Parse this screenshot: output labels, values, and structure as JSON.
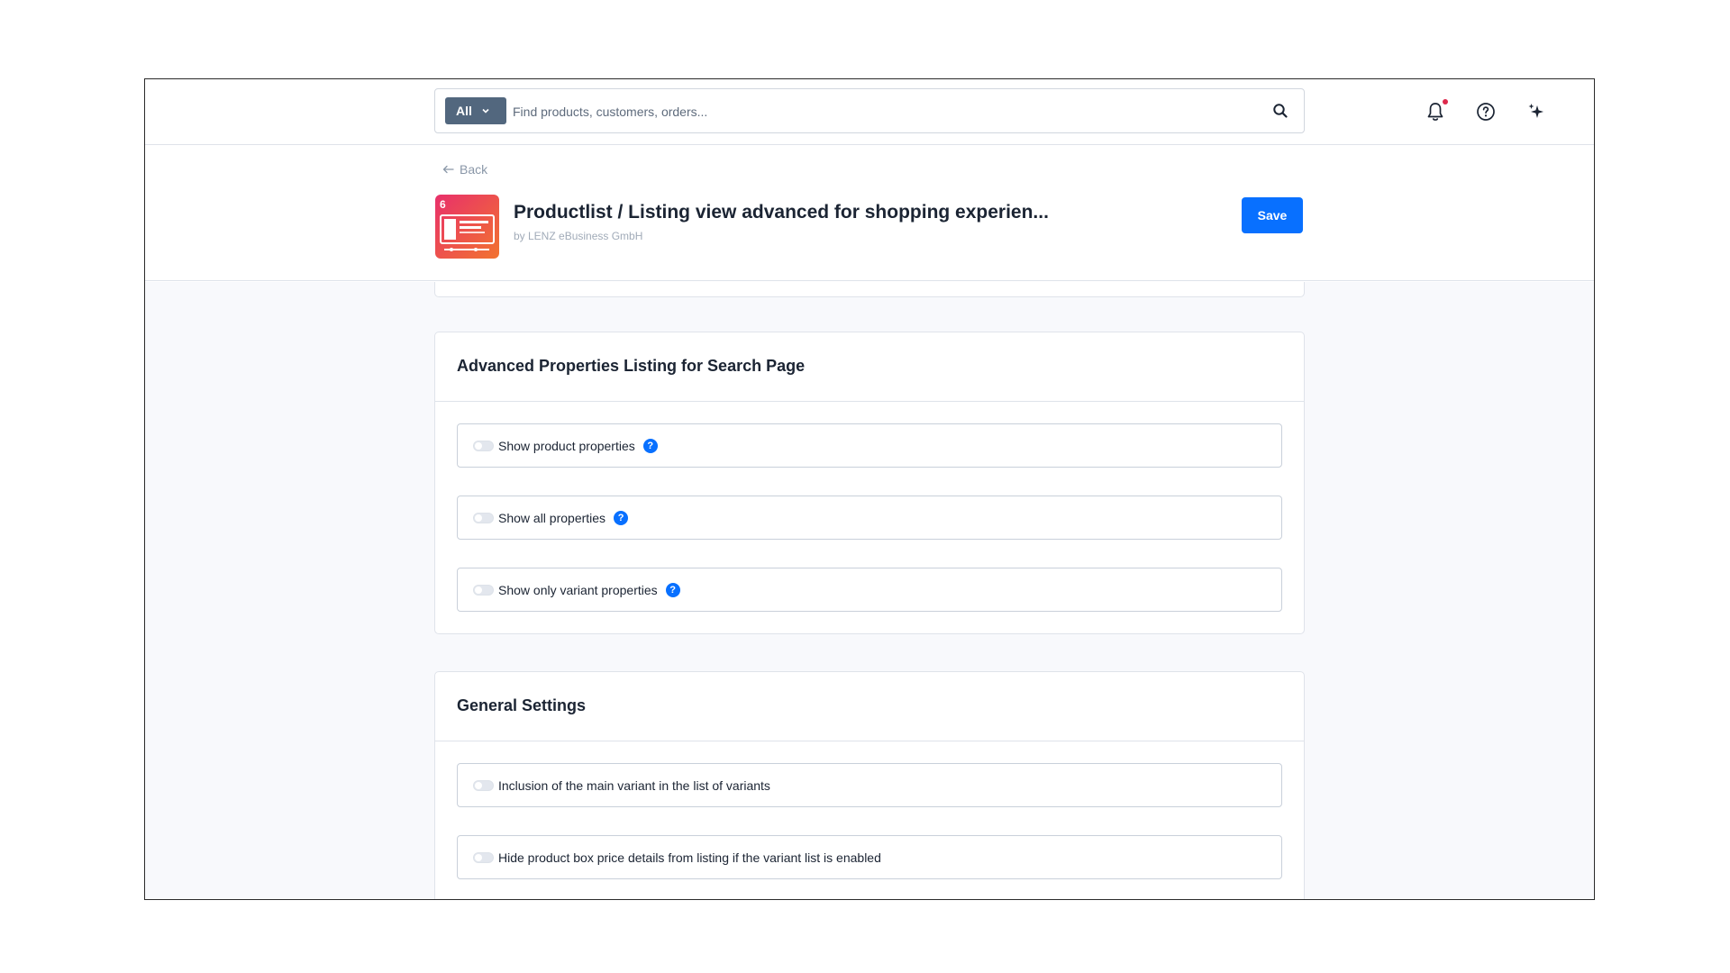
{
  "search": {
    "scope_label": "All",
    "placeholder": "Find products, customers, orders..."
  },
  "icons": {
    "search": "search-icon",
    "notifications": "bell-icon",
    "help": "question-circle-icon",
    "ai": "sparkle-icon"
  },
  "header": {
    "back_label": "Back",
    "title": "Productlist / Listing view advanced for shopping experien...",
    "vendor": "by LENZ eBusiness GmbH",
    "save_label": "Save"
  },
  "sections": [
    {
      "title": "Advanced Properties Listing for Search Page",
      "items": [
        {
          "label": "Show product properties",
          "enabled": false,
          "has_help": true
        },
        {
          "label": "Show all properties",
          "enabled": false,
          "has_help": true
        },
        {
          "label": "Show only variant properties",
          "enabled": false,
          "has_help": true
        }
      ]
    },
    {
      "title": "General Settings",
      "items": [
        {
          "label": "Inclusion of the main variant in the list of variants",
          "enabled": false,
          "has_help": false
        },
        {
          "label": "Hide product box price details from listing if the variant list is enabled",
          "enabled": false,
          "has_help": false
        }
      ]
    }
  ],
  "colors": {
    "primary": "#0870ff",
    "scope_button": "#52677e",
    "notification_dot": "#de294c",
    "app_icon_gradient": [
      "#e8306b",
      "#f2732f"
    ]
  }
}
